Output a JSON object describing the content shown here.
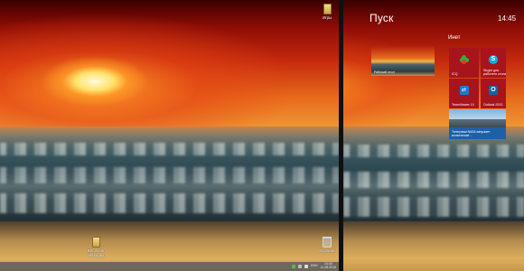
{
  "desktop": {
    "icons": [
      {
        "label": "Игры",
        "icon": "folder-icon"
      },
      {
        "label": "Веселые Эпизоды",
        "icon": "folder-icon"
      },
      {
        "label": "Корзина",
        "icon": "recycle-bin-icon"
      }
    ]
  },
  "taskbar": {
    "language": "ENG",
    "time": "14:45",
    "date": "11.08.2015"
  },
  "start": {
    "title": "Пуск",
    "time": "14:45",
    "group_title": "Инет",
    "tiles": [
      {
        "label": "Рабочий стол",
        "icon": "desktop-wallpaper"
      },
      {
        "label": "ICQ",
        "icon": "icq-icon",
        "color": "#a8141b"
      },
      {
        "label": "Skype для рабочего стола",
        "icon": "skype-icon",
        "color": "#a8141b"
      },
      {
        "label": "TeamViewer 10",
        "icon": "teamviewer-icon",
        "color": "#a8141b"
      },
      {
        "label": "Outlook 2013",
        "icon": "outlook-icon",
        "color": "#a8141b"
      },
      {
        "label": "Телеграмм NASA запускает космические ...",
        "icon": "news-photo",
        "color": "#1f5fa8"
      }
    ]
  }
}
